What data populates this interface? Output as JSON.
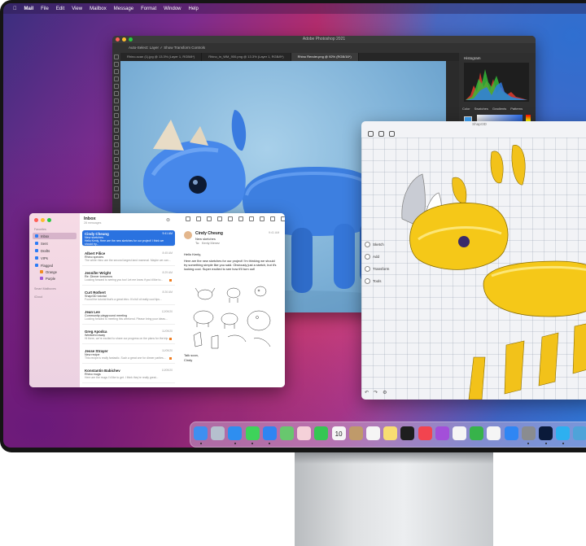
{
  "menubar": {
    "app": "Mail",
    "items": [
      "File",
      "Edit",
      "View",
      "Mailbox",
      "Message",
      "Format",
      "Window",
      "Help"
    ]
  },
  "photoshop": {
    "title": "Adobe Photoshop 2021",
    "options_bar": "Auto-Select:  Layer  ✓ Show Transform Controls",
    "tabs": [
      "Rhino-scan (1).jpg @ 13.3% (Layer 1, RGB/8*)",
      "Rhino_in_WM_900.png @ 13.3% (Layer 1, RGB/8*)",
      "Rhino Render.png @ 92% (RGB/16*)"
    ],
    "panel_title": "Histogram",
    "color_tabs": [
      "Color",
      "Swatches",
      "Gradients",
      "Patterns"
    ]
  },
  "shapr": {
    "title": "Shapr3D",
    "tools": [
      "Sketch",
      "Add",
      "Transform",
      "Tools"
    ]
  },
  "mail": {
    "sidebar": {
      "favorites_label": "Favorites",
      "items": [
        "Inbox",
        "Sent",
        "Drafts",
        "VIPs",
        "Flagged",
        "Orange",
        "Purple"
      ],
      "smart_label": "Smart Mailboxes",
      "icloud_label": "iCloud"
    },
    "list": {
      "title": "Inbox",
      "count": "28 messages",
      "messages": [
        {
          "from": "Cindy Cheung",
          "subject": "New sketches",
          "preview": "Hello Kenly, Here are the new sketches for our project! I think we should try...",
          "time": "9:41 AM"
        },
        {
          "from": "Albert Filice",
          "subject": "Rhino species",
          "preview": "The white rhino are the second largest land mammal. Maybe we can...",
          "time": "8:45 AM"
        },
        {
          "from": "Jennifer Wright",
          "subject": "Re: Dinner tomorrow",
          "preview": "Looking forward to seeing you too! Let me know if you'd like to...",
          "time": "8:29 AM"
        },
        {
          "from": "Curt Rothert",
          "subject": "Shapr3D tutorial",
          "preview": "Found the tutorial that's a great intro. It's full of really cool tips...",
          "time": "8:26 AM"
        },
        {
          "from": "Jean Lee",
          "subject": "Community playground meeting",
          "preview": "Looking forward to meeting this weekend. Please bring your ideas...",
          "time": "12/09/20"
        },
        {
          "from": "Greg Apodca",
          "subject": "Weekend away",
          "preview": "Hi there, we're excited to share our progress on the plans for the trip...",
          "time": "11/09/20"
        },
        {
          "from": "Jesse Strayer",
          "subject": "New recipe",
          "preview": "This recipe is really fantastic. Such a great one for dinner parties...",
          "time": "11/09/20"
        },
        {
          "from": "Konstantin Babichev",
          "subject": "Rhino mugs",
          "preview": "Here are the mugs I'd like to get. I think they're really great...",
          "time": "10/09/20"
        }
      ]
    },
    "detail": {
      "from": "Cindy Cheung",
      "subject": "New sketches",
      "to_label": "To:",
      "to": "Kenly Menez",
      "time": "9:41 AM",
      "greeting": "Hello Kenly,",
      "body": "Here are the new sketches for our project! I'm thinking we should try something simple like you said. Obviously just a sketch, but it's looking cool. Super excited to see how it'll turn out!",
      "sign1": "Talk soon,",
      "sign2": "Cindy"
    }
  },
  "dock": {
    "apps": [
      {
        "name": "finder",
        "color": "#3d8ff0"
      },
      {
        "name": "launchpad",
        "color": "#b5c0ce"
      },
      {
        "name": "safari",
        "color": "#2e8ef0"
      },
      {
        "name": "messages",
        "color": "#3ed35a"
      },
      {
        "name": "mail",
        "color": "#2f85f2"
      },
      {
        "name": "maps",
        "color": "#68c76e"
      },
      {
        "name": "photos",
        "color": "#f5d1d9"
      },
      {
        "name": "facetime",
        "color": "#35c653"
      },
      {
        "name": "calendar",
        "color": "#f6f6f6"
      },
      {
        "name": "contacts",
        "color": "#bf9a6a"
      },
      {
        "name": "reminders",
        "color": "#f5f5f5"
      },
      {
        "name": "notes",
        "color": "#f8dd72"
      },
      {
        "name": "tv",
        "color": "#1e1e1e"
      },
      {
        "name": "music",
        "color": "#f2444f"
      },
      {
        "name": "podcasts",
        "color": "#a34fd9"
      },
      {
        "name": "news",
        "color": "#f5f5f5"
      },
      {
        "name": "numbers",
        "color": "#37b34a"
      },
      {
        "name": "keynote",
        "color": "#f5f5f5"
      },
      {
        "name": "app-store",
        "color": "#2f86f3"
      },
      {
        "name": "system-preferences",
        "color": "#8a8c90"
      },
      {
        "name": "photoshop",
        "color": "#0a1a3a"
      },
      {
        "name": "shapr3d",
        "color": "#2db0f0"
      },
      {
        "name": "folder",
        "color": "#4fa3d9"
      }
    ],
    "calendar_day": "10"
  }
}
